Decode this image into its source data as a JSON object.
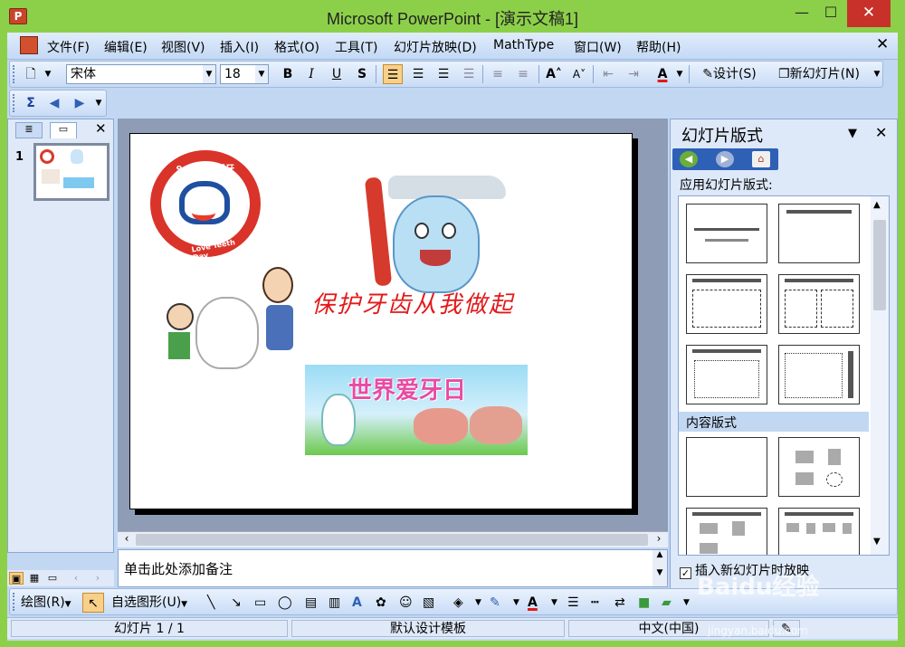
{
  "window": {
    "title": "Microsoft PowerPoint - [演示文稿1]",
    "min": "—",
    "max": "☐",
    "close": "✕"
  },
  "menubar": {
    "items": [
      "文件(F)",
      "编辑(E)",
      "视图(V)",
      "插入(I)",
      "格式(O)",
      "工具(T)",
      "幻灯片放映(D)",
      "MathType",
      "窗口(W)",
      "帮助(H)"
    ],
    "close": "✕"
  },
  "format_toolbar": {
    "font": "宋体",
    "size": "18",
    "bold": "B",
    "italic": "I",
    "underline": "U",
    "shadow": "S",
    "design_label": "设计(S)",
    "new_slide_label": "新幻灯片(N)"
  },
  "left_pane": {
    "slide_number": "1",
    "close": "✕"
  },
  "slide": {
    "logo_top_text": "9.20全国爱牙日",
    "logo_bottom_text": "Love Teeth Day",
    "slogan": "保护牙齿从我做起",
    "banner_title": "世界爱牙日"
  },
  "notes": {
    "placeholder": "单击此处添加备注"
  },
  "task_pane": {
    "title": "幻灯片版式",
    "close": "✕",
    "apply_label": "应用幻灯片版式:",
    "section_content": "内容版式",
    "checkbox_label": "插入新幻灯片时放映",
    "checkbox_checked": "✓"
  },
  "drawing_toolbar": {
    "draw_label": "绘图(R)",
    "autoshape_label": "自选图形(U)"
  },
  "statusbar": {
    "slide_info": "幻灯片 1 / 1",
    "template": "默认设计模板",
    "language": "中文(中国)"
  },
  "watermark": {
    "text": "Baidu经验",
    "url": "jingyan.baidu.com"
  },
  "colors": {
    "titlebar": "#8cd04a",
    "accent_red": "#e21a1a",
    "toolbar_blue": "#c8dcf6"
  }
}
